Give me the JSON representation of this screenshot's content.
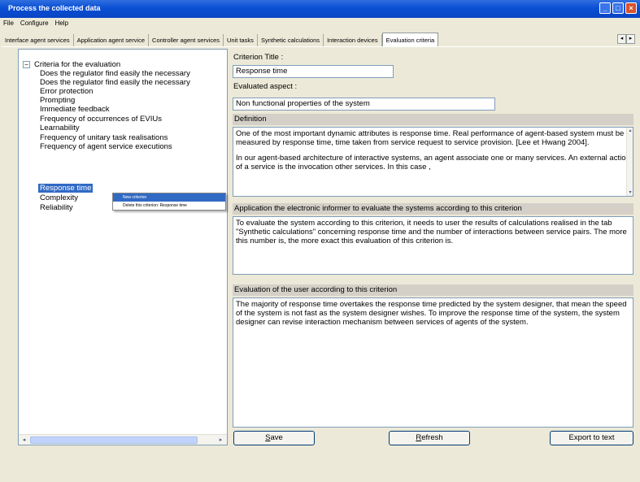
{
  "window": {
    "title": "Process the collected data",
    "controls": {
      "minimize": "_",
      "maximize": "□",
      "close": "×"
    }
  },
  "menu": [
    "File",
    "Configure",
    "Help"
  ],
  "tabs": [
    "Interface agent services",
    "Application agent service",
    "Controller agent services",
    "Unit tasks",
    "Synthetic calculations",
    "Interaction devices",
    "Evaluation criteria"
  ],
  "tab_scroll": {
    "left": "◂",
    "right": "▸"
  },
  "tree": {
    "collapse_symbol": "−",
    "root": "Criteria for the evaluation",
    "items": [
      "Does the regulator find easily the necessary",
      "Does the regulator find easily the necessary",
      "Error protection",
      "Prompting",
      "Immediate feedback",
      "Frequency of occurrences of EVIUs",
      "Learnability",
      "Frequency of unitary task realisations",
      "Frequency of agent service executions",
      "Response time",
      "Complexity",
      "Reliability"
    ],
    "selected": "Response time",
    "scroll_left": "◂",
    "scroll_right": "▸"
  },
  "context_menu": {
    "items": [
      "New criterion",
      "Delete this criterion: Response time"
    ]
  },
  "form": {
    "criterion_title_label": "Criterion Title :",
    "criterion_title_value": "Response time",
    "evaluated_aspect_label": "Evaluated aspect :",
    "evaluated_aspect_value": "Non functional properties of the system",
    "definition_label": "Definition",
    "definition_p1": "One of the most important dynamic attributes is response time. Real performance of agent-based system must be measured by response time, time taken from service request to service provision. [Lee et Hwang 2004].",
    "definition_p2": "In our agent-based architecture of interactive systems, an agent associate one or many services. An external action of a service is the invocation other services. In this case ,",
    "application_label": "Application the electronic informer to evaluate the systems according to this criterion",
    "application_text": "To evaluate the system according to this criterion, it needs to user the results of calculations realised in the tab \"Synthetic calculations\" concerning response time and the number of interactions between service pairs. The more this number is, the more exact this evaluation of this criterion is.",
    "user_eval_label": "Evaluation of the user according to this criterion",
    "user_eval_text": "The majority of response time overtakes the response time predicted by the system designer, that mean the speed of the system is not fast as the system designer wishes. To improve the response time of the system, the system designer can revise interaction mechanism between services of agents of the system.",
    "scroll_up": "▴",
    "scroll_down": "▾"
  },
  "buttons": {
    "save_u": "S",
    "save_rest": "ave",
    "refresh_u": "R",
    "refresh_rest": "efresh",
    "export": "Export to text"
  },
  "colors": {
    "titlebar": "#0a4fd4",
    "selection": "#316ac5",
    "window_bg": "#ece9d8",
    "section_bar": "#d4d0c8"
  }
}
